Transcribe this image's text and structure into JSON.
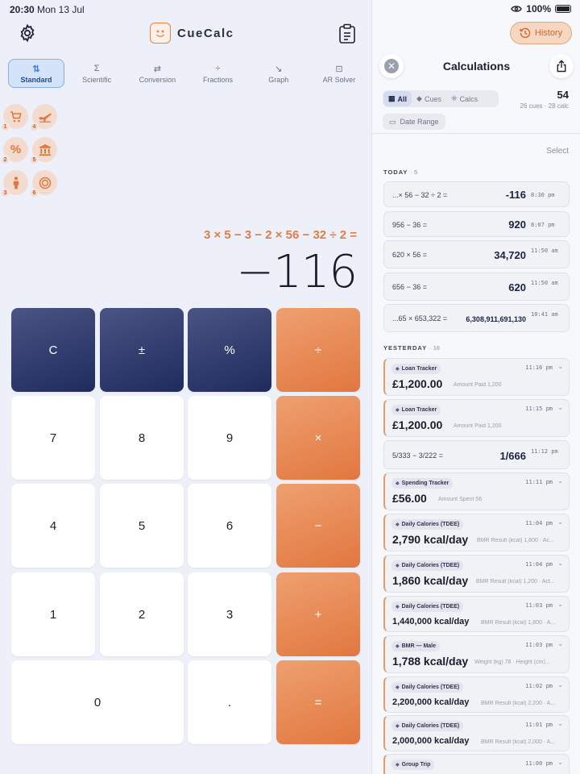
{
  "status": {
    "time": "20:30",
    "date": "Mon 13 Jul",
    "battery": "100%"
  },
  "app": {
    "name": "CueCalc"
  },
  "modes": [
    {
      "label": "Standard",
      "icon": "⇅"
    },
    {
      "label": "Scientific",
      "icon": "Σ"
    },
    {
      "label": "Conversion",
      "icon": "⇄"
    },
    {
      "label": "Fractions",
      "icon": "÷"
    },
    {
      "label": "Graph",
      "icon": "↘"
    },
    {
      "label": "AR Solver",
      "icon": "⊡"
    }
  ],
  "shortcuts": [
    {
      "icon": "cart-icon",
      "num": "1"
    },
    {
      "icon": "plane-icon",
      "num": "4"
    },
    {
      "icon": "percent-icon",
      "num": "2"
    },
    {
      "icon": "bank-icon",
      "num": "5"
    },
    {
      "icon": "person-icon",
      "num": "3"
    },
    {
      "icon": "plate-icon",
      "num": "6"
    }
  ],
  "display": {
    "expression": "3 × 5 − 3 − 2 × 56 − 32 ÷ 2 =",
    "result": "−116"
  },
  "keys": [
    {
      "label": "C",
      "kind": "dark"
    },
    {
      "label": "±",
      "kind": "dark"
    },
    {
      "label": "%",
      "kind": "dark"
    },
    {
      "label": "÷",
      "kind": "op"
    },
    {
      "label": "7",
      "kind": "num"
    },
    {
      "label": "8",
      "kind": "num"
    },
    {
      "label": "9",
      "kind": "num"
    },
    {
      "label": "×",
      "kind": "op"
    },
    {
      "label": "4",
      "kind": "num"
    },
    {
      "label": "5",
      "kind": "num"
    },
    {
      "label": "6",
      "kind": "num"
    },
    {
      "label": "−",
      "kind": "op"
    },
    {
      "label": "1",
      "kind": "num"
    },
    {
      "label": "2",
      "kind": "num"
    },
    {
      "label": "3",
      "kind": "num"
    },
    {
      "label": "+",
      "kind": "op"
    },
    {
      "label": "0",
      "kind": "num"
    },
    {
      "label": ".",
      "kind": "num"
    },
    {
      "label": "=",
      "kind": "op"
    }
  ],
  "history": {
    "button_label": "History",
    "title": "Calculations",
    "filters": [
      "All",
      "Cues",
      "Calcs"
    ],
    "total": "54",
    "breakdown": "26 cues · 28 calc",
    "date_range": "Date Range",
    "select": "Select",
    "today_label": "TODAY",
    "today_count": "· 5",
    "today": [
      {
        "expr": "...× 56 − 32 ÷ 2 =",
        "value": "-116",
        "time": "8:30 pm"
      },
      {
        "expr": "956 − 36 =",
        "value": "920",
        "time": "8:07 pm"
      },
      {
        "expr": "620 × 56 =",
        "value": "34,720",
        "time": "11:50 am"
      },
      {
        "expr": "656 − 36 =",
        "value": "620",
        "time": "11:50 am"
      },
      {
        "expr": "...65 × 653,322 =",
        "value": "6,308,911,691,130",
        "time": "10:41 am"
      }
    ],
    "yesterday_label": "YESTERDAY",
    "yesterday_count": "· 16",
    "yesterday": [
      {
        "type": "cue",
        "tag": "Loan Tracker",
        "time": "11:16 pm",
        "amount": "£1,200.00",
        "sub": "Amount Paid 1,200"
      },
      {
        "type": "cue",
        "tag": "Loan Tracker",
        "time": "11:15 pm",
        "amount": "£1,200.00",
        "sub": "Amount Paid 1,200"
      },
      {
        "type": "calc",
        "expr": "5/333 − 3/222 =",
        "value": "1/666",
        "time": "11:12 pm"
      },
      {
        "type": "cue",
        "tag": "Spending Tracker",
        "time": "11:11 pm",
        "amount": "£56.00",
        "sub": "Amount Spent 56"
      },
      {
        "type": "cue",
        "tag": "Daily Calories (TDEE)",
        "time": "11:04 pm",
        "amount": "2,790 kcal/day",
        "sub": "BMR Result (kcal) 1,800 · Ac..."
      },
      {
        "type": "cue",
        "tag": "Daily Calories (TDEE)",
        "time": "11:04 pm",
        "amount": "1,860 kcal/day",
        "sub": "BMR Result (kcal) 1,200 · Act..."
      },
      {
        "type": "cue",
        "tag": "Daily Calories (TDEE)",
        "time": "11:03 pm",
        "amount": "1,440,000 kcal/day",
        "sub": "BMR Result (kcal) 1,800 · A..."
      },
      {
        "type": "cue",
        "tag": "BMR — Male",
        "time": "11:03 pm",
        "amount": "1,788 kcal/day",
        "sub": "Weight (kg) 78 · Height (cm)..."
      },
      {
        "type": "cue",
        "tag": "Daily Calories (TDEE)",
        "time": "11:02 pm",
        "amount": "2,200,000 kcal/day",
        "sub": "BMR Result (kcal) 2,200 · A..."
      },
      {
        "type": "cue",
        "tag": "Daily Calories (TDEE)",
        "time": "11:01 pm",
        "amount": "2,000,000 kcal/day",
        "sub": "BMR Result (kcal) 2,000 · A..."
      },
      {
        "type": "cue",
        "tag": "Group Trip",
        "time": "11:00 pm",
        "amount": "",
        "sub": ""
      }
    ]
  }
}
